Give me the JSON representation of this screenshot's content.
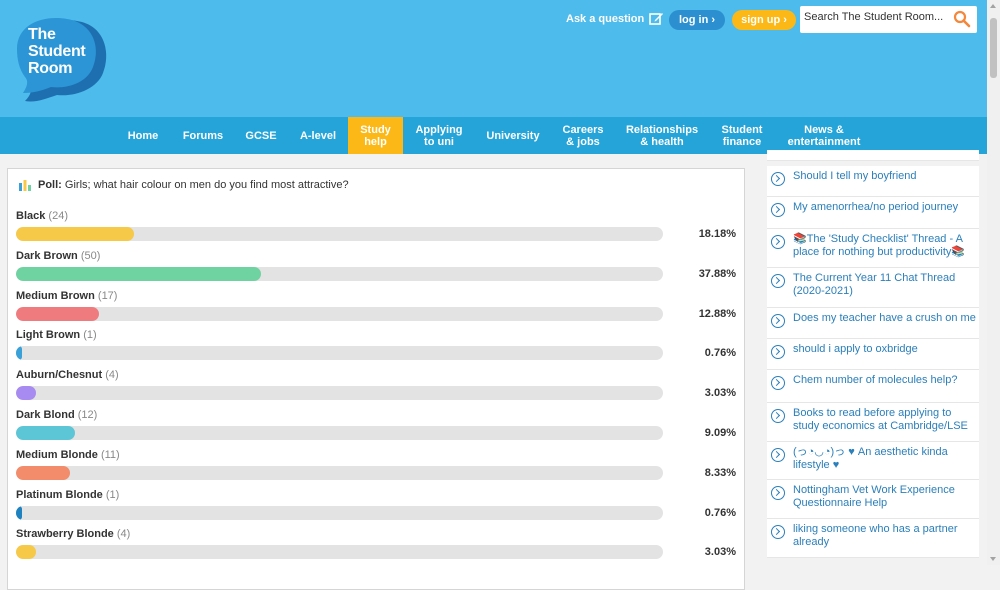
{
  "logo": {
    "line1": "The",
    "line2": "Student",
    "line3": "Room"
  },
  "header": {
    "ask_label": "Ask a question",
    "login_label": "log in ›",
    "signup_label": "sign up ›",
    "search_placeholder": "Search The Student Room..."
  },
  "nav": {
    "items": [
      {
        "l1": "Home",
        "l2": ""
      },
      {
        "l1": "Forums",
        "l2": ""
      },
      {
        "l1": "GCSE",
        "l2": ""
      },
      {
        "l1": "A-level",
        "l2": ""
      },
      {
        "l1": "Study",
        "l2": "help"
      },
      {
        "l1": "Applying",
        "l2": "to uni"
      },
      {
        "l1": "University",
        "l2": ""
      },
      {
        "l1": "Careers",
        "l2": "& jobs"
      },
      {
        "l1": "Relationships",
        "l2": "& health"
      },
      {
        "l1": "Student",
        "l2": "finance"
      },
      {
        "l1": "News &",
        "l2": "entertainment"
      }
    ],
    "active_index": 4
  },
  "poll": {
    "label": "Poll:",
    "question": "Girls; what hair colour on men do you find most attractive?",
    "options": [
      {
        "name": "Black",
        "count": "(24)",
        "pct": "18.18%",
        "fraction": 0.1818,
        "color": "#f7c948"
      },
      {
        "name": "Dark Brown",
        "count": "(50)",
        "pct": "37.88%",
        "fraction": 0.3788,
        "color": "#6fd3a1"
      },
      {
        "name": "Medium Brown",
        "count": "(17)",
        "pct": "12.88%",
        "fraction": 0.1288,
        "color": "#f07b7f"
      },
      {
        "name": "Light Brown",
        "count": "(1)",
        "pct": "0.76%",
        "fraction": 0.0076,
        "color": "#3aa0d8"
      },
      {
        "name": "Auburn/Chesnut",
        "count": "(4)",
        "pct": "3.03%",
        "fraction": 0.0303,
        "color": "#a78bf0"
      },
      {
        "name": "Dark Blond",
        "count": "(12)",
        "pct": "9.09%",
        "fraction": 0.0909,
        "color": "#5cc6d6"
      },
      {
        "name": "Medium Blonde",
        "count": "(11)",
        "pct": "8.33%",
        "fraction": 0.0833,
        "color": "#f28c6a"
      },
      {
        "name": "Platinum Blonde",
        "count": "(1)",
        "pct": "0.76%",
        "fraction": 0.0076,
        "color": "#1f82c0"
      },
      {
        "name": "Strawberry Blonde",
        "count": "(4)",
        "pct": "3.03%",
        "fraction": 0.0303,
        "color": "#f7c948"
      }
    ]
  },
  "sidebar": {
    "items": [
      "Should I tell my boyfriend",
      "My amenorrhea/no period journey",
      "📚The 'Study Checklist' Thread - A place for nothing but productivity📚",
      "The Current Year 11 Chat Thread (2020-2021)",
      "Does my teacher have a crush on me",
      "should i apply to oxbridge",
      "Chem number of molecules help?",
      "Books to read before applying to study economics at Cambridge/LSE",
      "(っ◔◡◔)っ ♥ An aesthetic kinda lifestyle ♥",
      "Nottingham Vet Work Experience Questionnaire Help",
      "liking someone who has a partner already"
    ]
  }
}
